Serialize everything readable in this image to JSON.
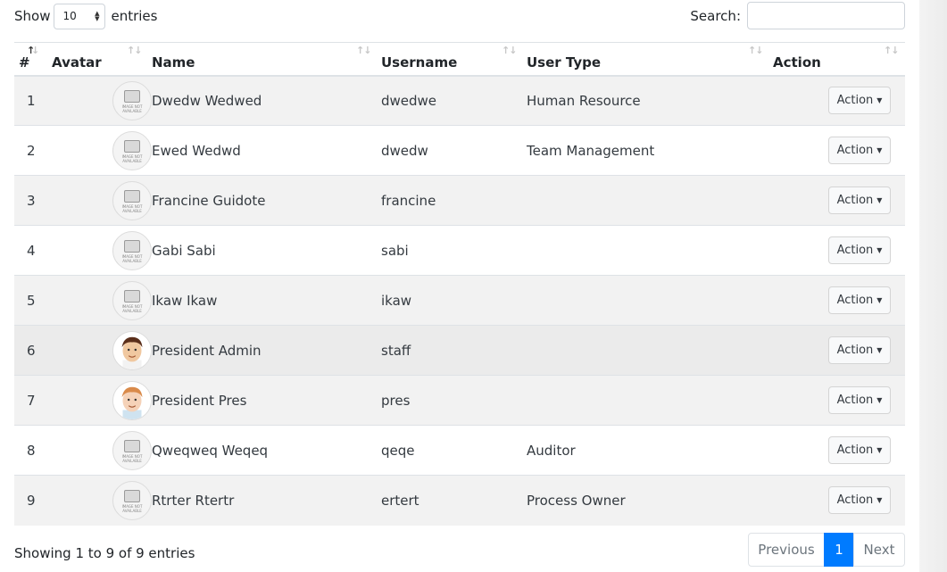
{
  "controls": {
    "show_label": "Show",
    "length_value": "10",
    "entries_label": "entries",
    "search_label": "Search:",
    "search_value": ""
  },
  "table": {
    "columns": [
      "#",
      "Avatar",
      "Name",
      "Username",
      "User Type",
      "Action"
    ],
    "rows": [
      {
        "num": "1",
        "avatar": "placeholder",
        "name": "Dwedw Wedwed",
        "username": "dwedwe",
        "user_type": "Human Resource",
        "action": "Action"
      },
      {
        "num": "2",
        "avatar": "placeholder",
        "name": "Ewed Wedwd",
        "username": "dwedw",
        "user_type": "Team Management",
        "action": "Action"
      },
      {
        "num": "3",
        "avatar": "placeholder",
        "name": "Francine Guidote",
        "username": "francine",
        "user_type": "",
        "action": "Action"
      },
      {
        "num": "4",
        "avatar": "placeholder",
        "name": "Gabi Sabi",
        "username": "sabi",
        "user_type": "",
        "action": "Action"
      },
      {
        "num": "5",
        "avatar": "placeholder",
        "name": "Ikaw Ikaw",
        "username": "ikaw",
        "user_type": "",
        "action": "Action"
      },
      {
        "num": "6",
        "avatar": "cartoon-man-dark-hair",
        "name": "President Admin",
        "username": "staff",
        "user_type": "",
        "action": "Action"
      },
      {
        "num": "7",
        "avatar": "cartoon-man-light-hair",
        "name": "President Pres",
        "username": "pres",
        "user_type": "",
        "action": "Action"
      },
      {
        "num": "8",
        "avatar": "placeholder",
        "name": "Qweqweq Weqeq",
        "username": "qeqe",
        "user_type": "Auditor",
        "action": "Action"
      },
      {
        "num": "9",
        "avatar": "placeholder",
        "name": "Rtrter Rtertr",
        "username": "ertert",
        "user_type": "Process Owner",
        "action": "Action"
      }
    ],
    "placeholder_text": "IMAGE NOT AVAILABLE"
  },
  "footer": {
    "info": "Showing 1 to 9 of 9 entries",
    "prev": "Previous",
    "current_page": "1",
    "next": "Next"
  },
  "colors": {
    "accent": "#007bff",
    "stripe": "#f2f2f2",
    "hover_row": "#ebebeb"
  }
}
